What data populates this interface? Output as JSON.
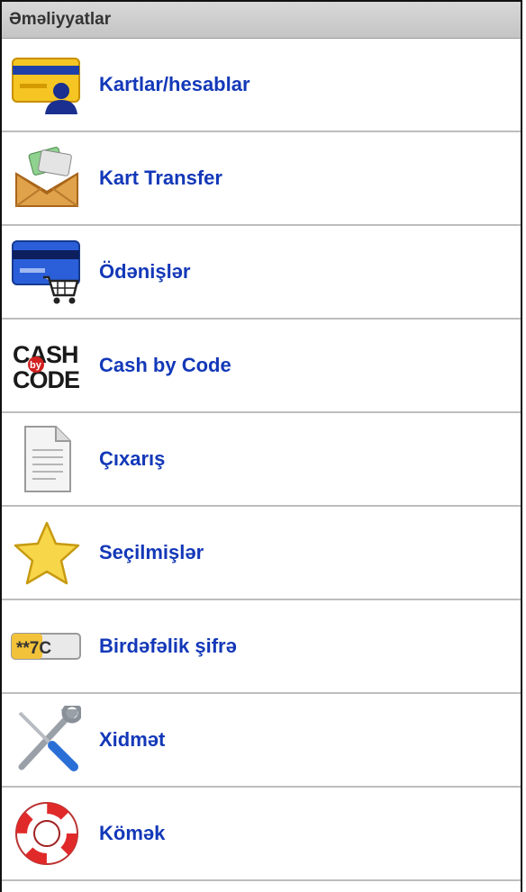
{
  "header": {
    "title": "Əməliyyatlar"
  },
  "menu": [
    {
      "label": "Kartlar/hesablar",
      "icon": "card-user-icon"
    },
    {
      "label": "Kart Transfer",
      "icon": "envelope-cards-icon"
    },
    {
      "label": "Ödənişlər",
      "icon": "card-cart-icon"
    },
    {
      "label": "Cash by Code",
      "icon": "cash-by-code-icon",
      "icon_text_top": "CASH",
      "icon_text_bottom": "CODE",
      "icon_badge": "by"
    },
    {
      "label": "Çıxarış",
      "icon": "document-icon"
    },
    {
      "label": "Seçilmişlər",
      "icon": "star-icon"
    },
    {
      "label": "Birdəfəlik şifrə",
      "icon": "one-time-password-icon",
      "icon_text": "**7C"
    },
    {
      "label": "Xidmət",
      "icon": "tools-icon"
    },
    {
      "label": "Kömək",
      "icon": "lifebuoy-icon"
    }
  ],
  "colors": {
    "label": "#1338b8",
    "header_bg": "#cfcfcf",
    "divider": "#bdbdbd"
  }
}
